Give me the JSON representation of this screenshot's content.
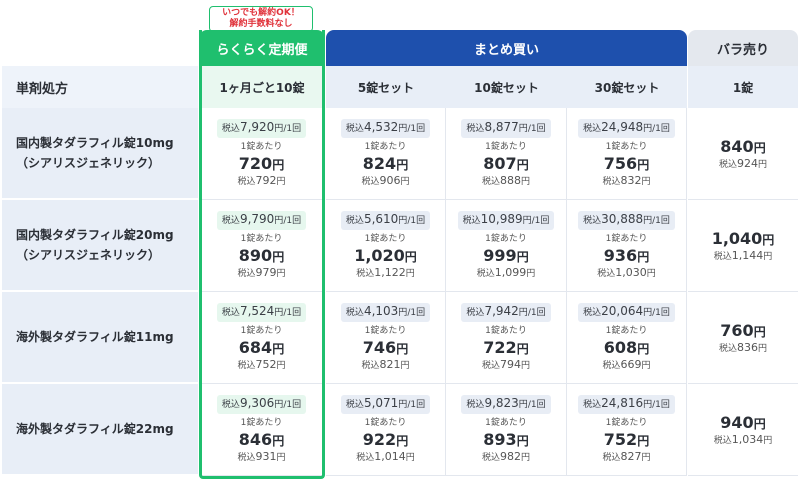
{
  "notice": {
    "line1": "いつでも解約OK！",
    "line2": "解約手数料なし"
  },
  "header": {
    "title": "単剤処方",
    "subscription": "らくらく定期便",
    "bulk": "まとめ買い",
    "single": "バラ売り"
  },
  "subheader": {
    "subscription": "1ヶ月ごと10錠",
    "bulk5": "5錠セット",
    "bulk10": "10錠セット",
    "bulk30": "30錠セット",
    "single": "1錠"
  },
  "labels": {
    "tax": "税込",
    "per_time": "/1回",
    "per_tablet": "1錠あたり",
    "yen": "円"
  },
  "rows": [
    {
      "name1": "国内製タダラフィル錠10mg",
      "name2": "（シアリスジェネリック）",
      "cells": [
        {
          "total": "7,920",
          "unit": "720",
          "unit_tax": "792"
        },
        {
          "total": "4,532",
          "unit": "824",
          "unit_tax": "906"
        },
        {
          "total": "8,877",
          "unit": "807",
          "unit_tax": "888"
        },
        {
          "total": "24,948",
          "unit": "756",
          "unit_tax": "832"
        }
      ],
      "single": {
        "price": "840",
        "tax": "924"
      }
    },
    {
      "name1": "国内製タダラフィル錠20mg",
      "name2": "（シアリスジェネリック）",
      "cells": [
        {
          "total": "9,790",
          "unit": "890",
          "unit_tax": "979"
        },
        {
          "total": "5,610",
          "unit": "1,020",
          "unit_tax": "1,122"
        },
        {
          "total": "10,989",
          "unit": "999",
          "unit_tax": "1,099"
        },
        {
          "total": "30,888",
          "unit": "936",
          "unit_tax": "1,030"
        }
      ],
      "single": {
        "price": "1,040",
        "tax": "1,144"
      }
    },
    {
      "name1": "海外製タダラフィル錠11mg",
      "name2": "",
      "cells": [
        {
          "total": "7,524",
          "unit": "684",
          "unit_tax": "752"
        },
        {
          "total": "4,103",
          "unit": "746",
          "unit_tax": "821"
        },
        {
          "total": "7,942",
          "unit": "722",
          "unit_tax": "794"
        },
        {
          "total": "20,064",
          "unit": "608",
          "unit_tax": "669"
        }
      ],
      "single": {
        "price": "760",
        "tax": "836"
      }
    },
    {
      "name1": "海外製タダラフィル錠22mg",
      "name2": "",
      "cells": [
        {
          "total": "9,306",
          "unit": "846",
          "unit_tax": "931"
        },
        {
          "total": "5,071",
          "unit": "922",
          "unit_tax": "1,014"
        },
        {
          "total": "9,823",
          "unit": "893",
          "unit_tax": "982"
        },
        {
          "total": "24,816",
          "unit": "752",
          "unit_tax": "827"
        }
      ],
      "single": {
        "price": "940",
        "tax": "1,034"
      }
    }
  ]
}
